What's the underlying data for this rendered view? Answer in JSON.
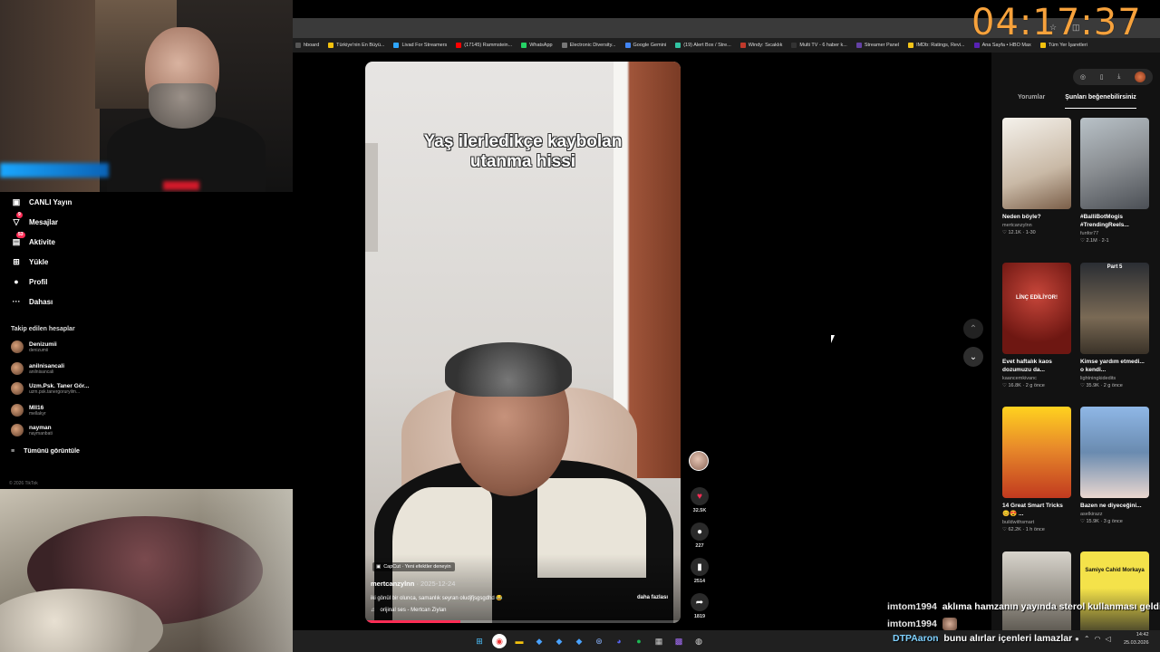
{
  "stream": {
    "timer": "04:17:37"
  },
  "bookmarks": [
    {
      "label": "hboard",
      "color": "#555"
    },
    {
      "label": "Türkiye'nin En Büyü...",
      "color": "#f4c20d"
    },
    {
      "label": "Livad For Streamers",
      "color": "#2ea6ff"
    },
    {
      "label": "(17145) Rammstein...",
      "color": "#ff0000"
    },
    {
      "label": "WhatsApp",
      "color": "#25d366"
    },
    {
      "label": "Electronic Diversity...",
      "color": "#777"
    },
    {
      "label": "Google Gemini",
      "color": "#4285f4"
    },
    {
      "label": "(19) Alert Box / Stre...",
      "color": "#31c3a2"
    },
    {
      "label": "Windy: Sıcaklık",
      "color": "#c0392b"
    },
    {
      "label": "Multi TV - 6 haber k...",
      "color": "#333"
    },
    {
      "label": "Streamer Panel",
      "color": "#6441a5"
    },
    {
      "label": "IMDb: Ratings, Revi...",
      "color": "#f5c518"
    },
    {
      "label": "Ana Sayfa • HBO Max",
      "color": "#5822b4"
    },
    {
      "label": "Tüm Yer İşaretleri",
      "color": "#f4c20d"
    }
  ],
  "nav": {
    "items": [
      {
        "label": "CANLI Yayın",
        "icon": "▣",
        "badge": ""
      },
      {
        "label": "Mesajlar",
        "icon": "▽",
        "badge": "9"
      },
      {
        "label": "Aktivite",
        "icon": "▤",
        "badge": "53"
      },
      {
        "label": "Yükle",
        "icon": "⊞",
        "badge": ""
      },
      {
        "label": "Profil",
        "icon": "●",
        "badge": ""
      },
      {
        "label": "Dahası",
        "icon": "···",
        "badge": ""
      }
    ],
    "following_title": "Takip edilen hesaplar",
    "following": [
      {
        "name": "Denizumii",
        "handle": "denizumii"
      },
      {
        "name": "anilnisancali",
        "handle": "anilnisancali"
      },
      {
        "name": "Uzm.Psk. Taner Gör...",
        "handle": "uzm.psk.tanergoruryilm..."
      },
      {
        "name": "Mll16",
        "handle": "mellakyr"
      },
      {
        "name": "nayman",
        "handle": "naymanbati"
      }
    ],
    "see_all": "Tümünü görüntüle",
    "copyright": "© 2026 TikTok"
  },
  "video": {
    "caption_line1": "Yaş ilerledikçe kaybolan",
    "caption_line2": "utanma hissi",
    "capcut": "CapCut · Yeni efektler deneyin",
    "author": "mertcanzylnn",
    "date": " · 2025-12-24",
    "description": "iki gönül bir olunca, samanlık seyran oludjfjsgsgdhd 😂",
    "sound": "orijinal ses - Mertcan Ziylan",
    "more": "daha fazlası",
    "progress": 0.3,
    "likes": "32.5K",
    "comments": "227",
    "saves": "2514",
    "shares": "1819"
  },
  "right_panel": {
    "tab_comments": "Yorumlar",
    "tab_suggested": "Şunları beğenebilirsiniz",
    "cards": [
      {
        "title": "Neden böyle?",
        "user": "mertcanzylnn",
        "meta": "♡ 12.1K · 1-30",
        "thumb_text": ""
      },
      {
        "title": "#BalliBotMogis #TrendingReels...",
        "user": "funfor77",
        "meta": "♡ 2.1M · 2-1",
        "thumb_text": ""
      },
      {
        "title": "Evet haftalık kaos dozumuzu da...",
        "user": "kaancemkivanc",
        "meta": "♡ 16.8K · 2 g önce",
        "thumb_text": "LİNÇ EDİLİYOR!"
      },
      {
        "title": "Kimse yardım etmedi... o kendi...",
        "user": "lightningkidedits",
        "meta": "♡ 35.9K · 2 g önce",
        "thumb_text": "Part 5"
      },
      {
        "title": "14 Great Smart Tricks 😊😍 ...",
        "user": "buildwithsmart",
        "meta": "♡ 62.2K · 1 h önce",
        "thumb_text": ""
      },
      {
        "title": "Bazen ne diyeceğini...",
        "user": "aselkirazz",
        "meta": "♡ 15.9K · 3 g önce",
        "thumb_text": ""
      },
      {
        "title": "",
        "user": "",
        "meta": "",
        "thumb_text": ""
      },
      {
        "title": "",
        "user": "",
        "meta": "",
        "thumb_text": "Samiye Cahid Morkaya"
      }
    ]
  },
  "chat": [
    {
      "user": "imtom1994",
      "message": "aklıma hamzanın yayında sterol kullanması geldi"
    },
    {
      "user": "imtom1994",
      "message": ""
    },
    {
      "user": "DTPAaron",
      "message": "bunu alırlar içenleri lamazlar"
    }
  ],
  "taskbar": {
    "time": "14:42",
    "date": "25.03.2026"
  }
}
